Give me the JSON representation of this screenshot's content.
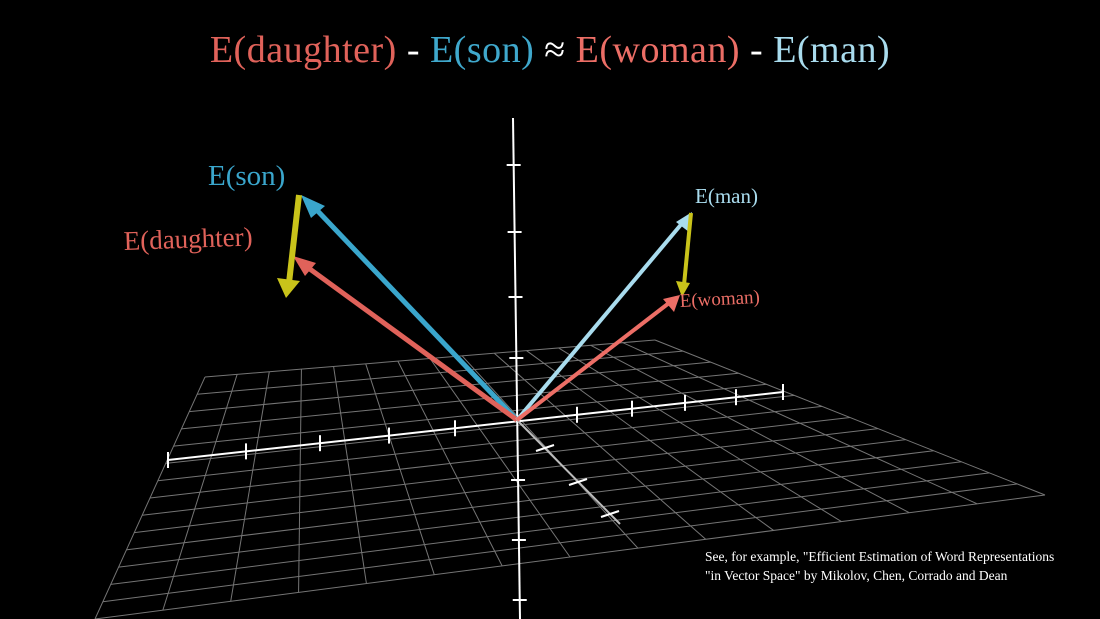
{
  "title": {
    "parts": [
      {
        "text": "E(daughter)",
        "color": "#e0625a"
      },
      {
        "text": " - ",
        "color": "#ffffff"
      },
      {
        "text": "E(son)",
        "color": "#3fa8cc"
      },
      {
        "text": " ≈ ",
        "color": "#ffffff"
      },
      {
        "text": "E(woman)",
        "color": "#ec6e66"
      },
      {
        "text": " - ",
        "color": "#ffffff"
      },
      {
        "text": "E(man)",
        "color": "#a9dcee"
      }
    ]
  },
  "vectors": {
    "son": {
      "label": "E(son)",
      "color": "#3aa6cc"
    },
    "daughter": {
      "label": "E(daughter)",
      "color": "#e0625a"
    },
    "man": {
      "label": "E(man)",
      "color": "#a9dcee"
    },
    "woman": {
      "label": "E(woman)",
      "color": "#ec6e66"
    },
    "difference_color": "#c9c31a"
  },
  "citation": {
    "line1": "See, for example, \"Efficient Estimation of Word Representations",
    "line2": "\"in Vector Space\" by Mikolov, Chen, Corrado and Dean"
  }
}
